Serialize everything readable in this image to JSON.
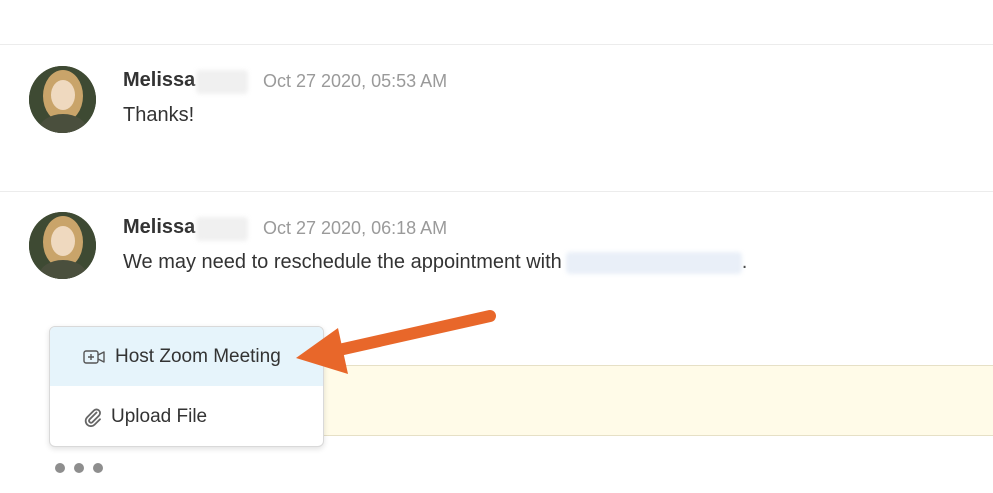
{
  "messages": [
    {
      "author": "Melissa",
      "timestamp": "Oct 27 2020, 05:53 AM",
      "text": "Thanks!"
    },
    {
      "author": "Melissa",
      "timestamp": "Oct 27 2020, 06:18 AM",
      "text": "We may need to reschedule the appointment with",
      "text_suffix": "."
    }
  ],
  "popup_menu": {
    "items": [
      {
        "label": "Host Zoom Meeting",
        "icon": "video-plus-icon",
        "state": "hovered"
      },
      {
        "label": "Upload File",
        "icon": "paperclip-icon",
        "state": "normal"
      }
    ]
  },
  "colors": {
    "hover_background": "#e6f4fb",
    "compose_background": "#fffbe8",
    "annotation_arrow": "#e8672a",
    "timestamp_text": "#9a9a9a"
  }
}
